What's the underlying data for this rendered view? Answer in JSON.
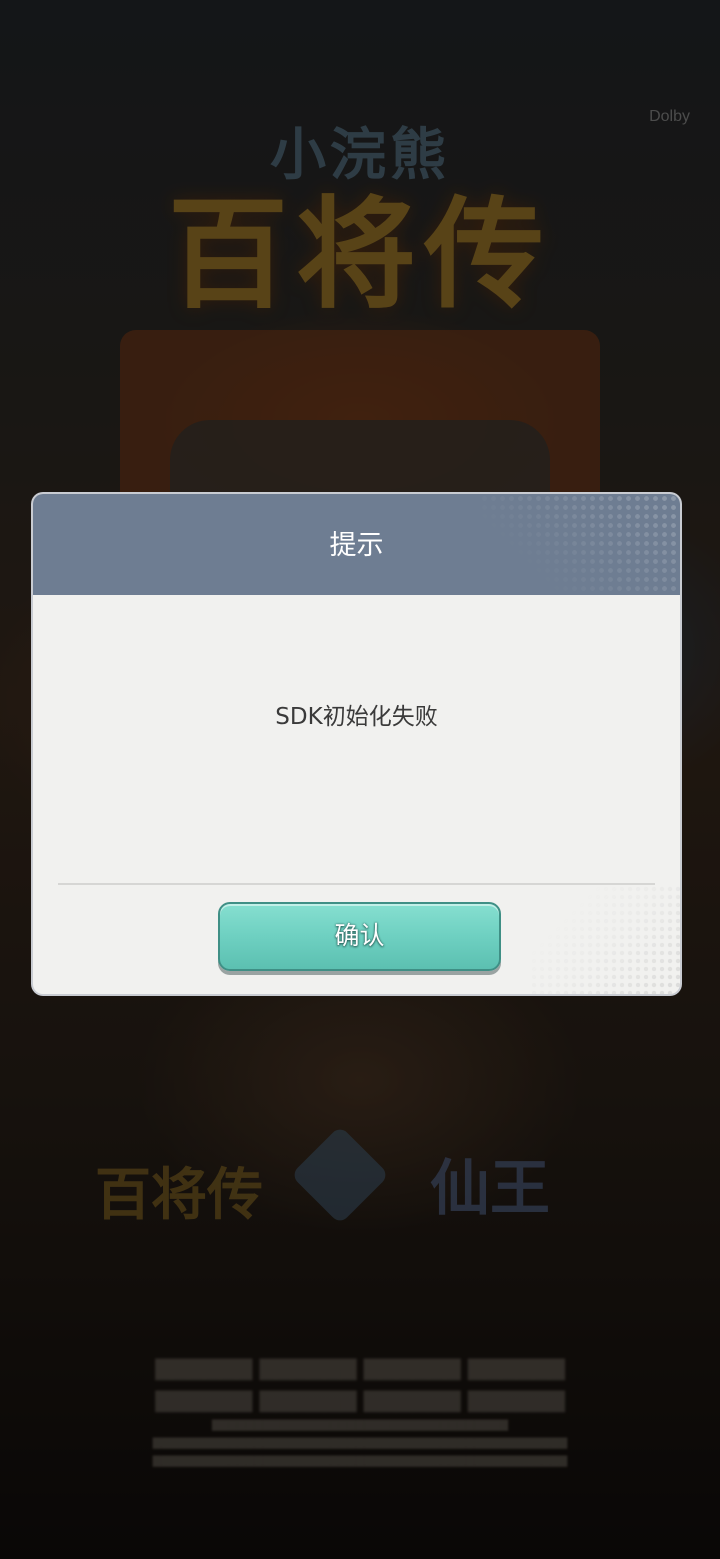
{
  "background": {
    "game_logo_small": "小浣熊",
    "game_logo_big": "百将传",
    "dolby_badge": "Dolby",
    "partner_logos": [
      "百将传",
      "",
      "仙王"
    ]
  },
  "dialog": {
    "title": "提示",
    "message": "SDK初始化失败",
    "confirm_label": "确认"
  },
  "colors": {
    "dialog_header": "#6e7d92",
    "dialog_body": "#f1f1ef",
    "confirm_button": "#6ed0c1"
  }
}
